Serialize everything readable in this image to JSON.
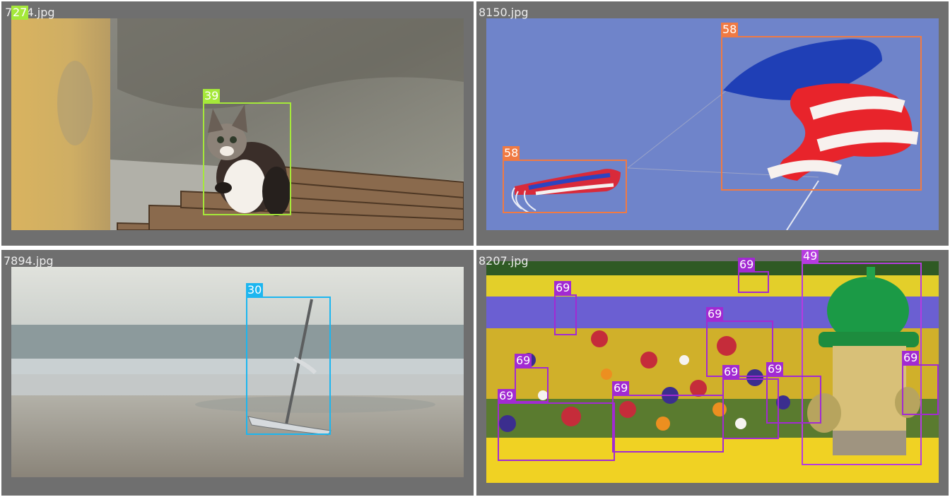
{
  "colors": {
    "tile_background": "#6f6f6f",
    "cat": "#a5e83a",
    "kite": "#f07a43",
    "boat": "#1cb6f0",
    "potted_plant": "#a22ad2",
    "fire_hydrant": "#b63be0"
  },
  "tiles": [
    {
      "filename": "7274.jpg",
      "filename_overlay_label": "27",
      "detections": [
        {
          "class_id": "39",
          "color": "#a5e83a"
        }
      ]
    },
    {
      "filename": "8150.jpg",
      "detections": [
        {
          "class_id": "58",
          "color": "#f07a43"
        },
        {
          "class_id": "58",
          "color": "#f07a43"
        }
      ]
    },
    {
      "filename": "7894.jpg",
      "detections": [
        {
          "class_id": "30",
          "color": "#1cb6f0"
        }
      ]
    },
    {
      "filename": "8207.jpg",
      "detections": [
        {
          "class_id": "69",
          "color": "#a22ad2"
        },
        {
          "class_id": "49",
          "color": "#b63be0"
        },
        {
          "class_id": "69",
          "color": "#a22ad2"
        },
        {
          "class_id": "69",
          "color": "#a22ad2"
        },
        {
          "class_id": "69",
          "color": "#a22ad2"
        },
        {
          "class_id": "69",
          "color": "#a22ad2"
        },
        {
          "class_id": "69",
          "color": "#a22ad2"
        },
        {
          "class_id": "69",
          "color": "#a22ad2"
        },
        {
          "class_id": "69",
          "color": "#a22ad2"
        },
        {
          "class_id": "69",
          "color": "#a22ad2"
        },
        {
          "class_id": "69",
          "color": "#a22ad2"
        }
      ]
    }
  ]
}
